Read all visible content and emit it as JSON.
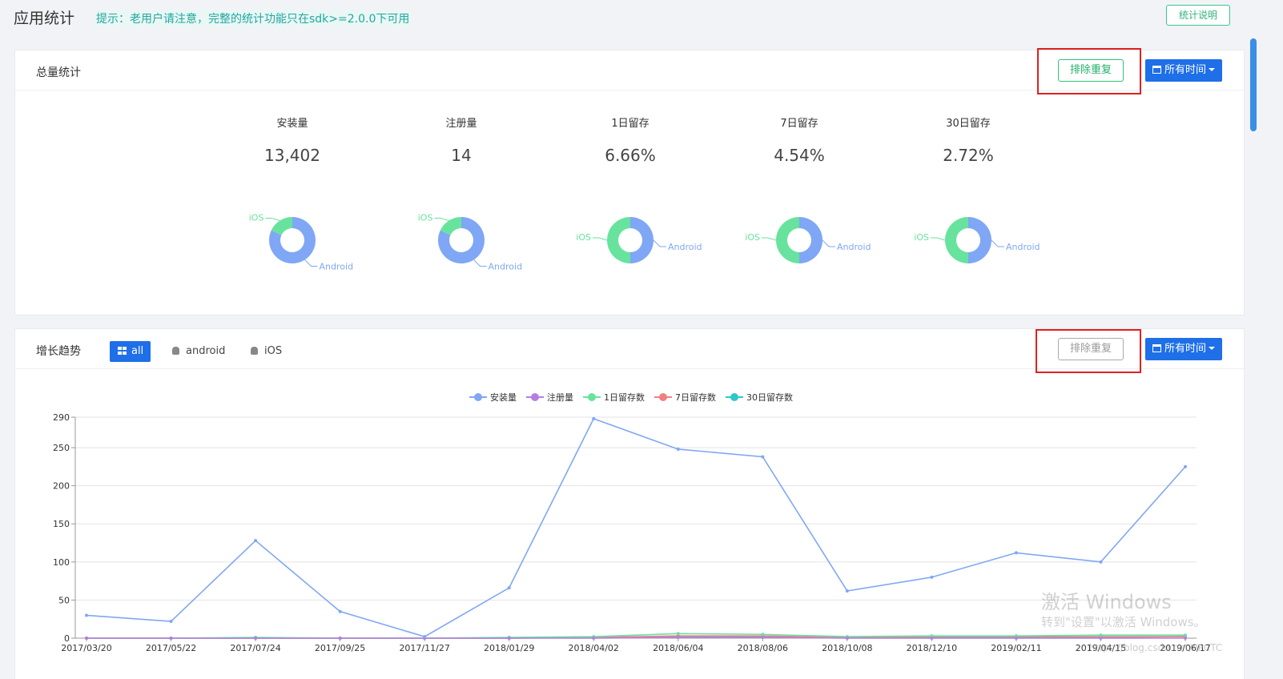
{
  "header": {
    "title": "应用统计",
    "tip": "提示：老用户请注意，完整的统计功能只在sdk>=2.0.0下可用",
    "explain_button": "统计说明"
  },
  "total_panel": {
    "title": "总量统计",
    "dedup_button": "排除重复",
    "time_button": "所有时间",
    "stats": [
      {
        "label": "安装量",
        "value": "13,402",
        "ios_share": 0.18
      },
      {
        "label": "注册量",
        "value": "14",
        "ios_share": 0.18
      },
      {
        "label": "1日留存",
        "value": "6.66%",
        "ios_share": 0.5
      },
      {
        "label": "7日留存",
        "value": "4.54%",
        "ios_share": 0.5
      },
      {
        "label": "30日留存",
        "value": "2.72%",
        "ios_share": 0.5
      }
    ],
    "donut_labels": {
      "ios": "iOS",
      "android": "Android"
    }
  },
  "trend_panel": {
    "title": "增长趋势",
    "tabs": [
      {
        "label": "all",
        "icon": "grid-icon"
      },
      {
        "label": "android",
        "icon": "android-icon"
      },
      {
        "label": "iOS",
        "icon": "apple-icon"
      }
    ],
    "dedup_button": "排除重复",
    "time_button": "所有时间"
  },
  "colors": {
    "android": "#7fa7f5",
    "ios": "#67e39e",
    "accent": "#1e6fe8",
    "highlight_box": "#e02020"
  },
  "chart_data": {
    "type": "line",
    "legend_position": "top-center",
    "grid": true,
    "ylim": [
      0,
      290
    ],
    "yticks": [
      0,
      50,
      100,
      150,
      200,
      250,
      290
    ],
    "x": [
      "2017/03/20",
      "2017/05/22",
      "2017/07/24",
      "2017/09/25",
      "2017/11/27",
      "2018/01/29",
      "2018/04/02",
      "2018/06/04",
      "2018/08/06",
      "2018/10/08",
      "2018/12/10",
      "2019/02/11",
      "2019/04/15",
      "2019/06/17"
    ],
    "series": [
      {
        "name": "安装量",
        "color": "#7fa7f5",
        "values": [
          30,
          22,
          128,
          35,
          2,
          66,
          288,
          248,
          238,
          62,
          80,
          112,
          100,
          225
        ]
      },
      {
        "name": "注册量",
        "color": "#b57ee0",
        "values": [
          0,
          0,
          0,
          0,
          0,
          0,
          0,
          1,
          1,
          0,
          0,
          0,
          0,
          0
        ]
      },
      {
        "name": "1日留存数",
        "color": "#67e39e",
        "values": [
          0,
          0,
          1,
          0,
          0,
          1,
          2,
          6,
          5,
          2,
          3,
          3,
          4,
          4
        ]
      },
      {
        "name": "7日留存数",
        "color": "#f08080",
        "values": [
          0,
          0,
          0,
          0,
          0,
          0,
          1,
          3,
          3,
          1,
          2,
          2,
          2,
          2
        ]
      },
      {
        "name": "30日留存数",
        "color": "#2ec8c8",
        "values": [
          0,
          0,
          0,
          0,
          0,
          0,
          1,
          2,
          2,
          1,
          1,
          1,
          1,
          2
        ]
      }
    ]
  },
  "watermark": {
    "line1": "激活 Windows",
    "line2": "转到\"设置\"以激活 Windows。",
    "line3": "https://blog.csdn.net/PPCTC"
  }
}
